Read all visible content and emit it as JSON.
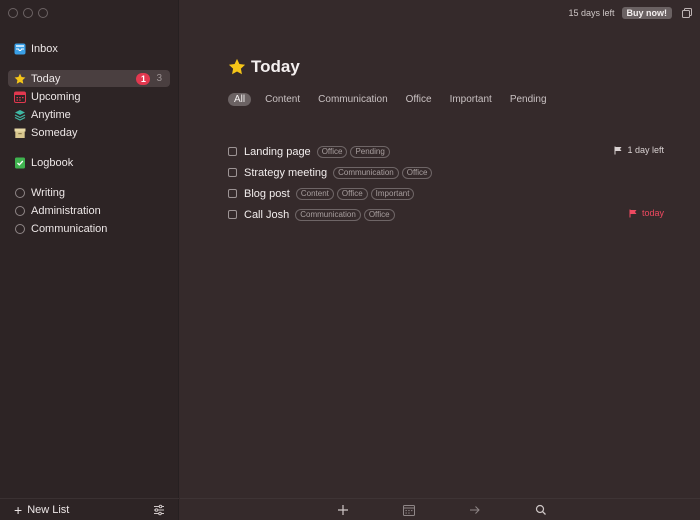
{
  "window": {
    "trial_text": "15 days left",
    "buy_label": "Buy now!"
  },
  "sidebar": {
    "inbox": {
      "label": "Inbox",
      "icon": "inbox-icon"
    },
    "items": [
      {
        "label": "Today",
        "icon": "star-icon",
        "badge": "1",
        "count": "3",
        "selected": true
      },
      {
        "label": "Upcoming",
        "icon": "calendar-icon"
      },
      {
        "label": "Anytime",
        "icon": "layers-icon"
      },
      {
        "label": "Someday",
        "icon": "archive-box-icon"
      }
    ],
    "logbook": {
      "label": "Logbook",
      "icon": "logbook-icon"
    },
    "areas": [
      {
        "label": "Writing"
      },
      {
        "label": "Administration"
      },
      {
        "label": "Communication"
      }
    ],
    "footer": {
      "new_list_label": "New List"
    }
  },
  "main": {
    "title": "Today",
    "filters": [
      "All",
      "Content",
      "Communication",
      "Office",
      "Important",
      "Pending"
    ],
    "tasks": [
      {
        "title": "Landing page",
        "tags": [
          "Office",
          "Pending"
        ],
        "deadline": "1 day left",
        "deadline_style": "normal"
      },
      {
        "title": "Strategy meeting",
        "tags": [
          "Communication",
          "Office"
        ],
        "deadline": "",
        "deadline_style": ""
      },
      {
        "title": "Blog post",
        "tags": [
          "Content",
          "Office",
          "Important"
        ],
        "deadline": "",
        "deadline_style": ""
      },
      {
        "title": "Call Josh",
        "tags": [
          "Communication",
          "Office"
        ],
        "deadline": "today",
        "deadline_style": "overdue"
      }
    ]
  },
  "colors": {
    "sidebar_bg": "#2d2425",
    "main_bg": "#352a2b",
    "accent_red": "#e2384f",
    "inbox_blue": "#3aa0e8",
    "star_yellow": "#f5c518",
    "logbook_green": "#3fb34f"
  }
}
